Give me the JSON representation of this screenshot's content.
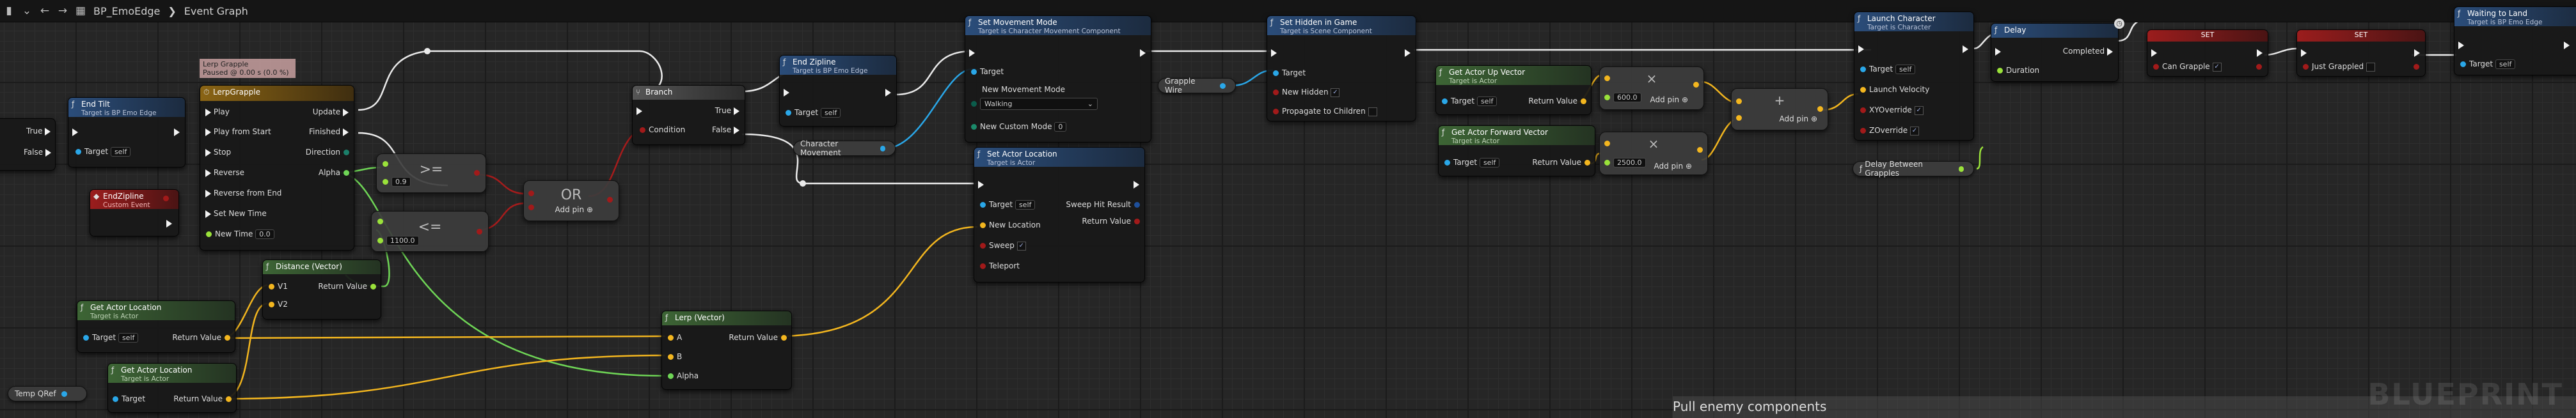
{
  "toolbar": {
    "breadcrumb_root": "BP_EmoEdge",
    "breadcrumb_sep": "❯",
    "breadcrumb_graph": "Event Graph"
  },
  "branch_left": {
    "true_label": "True",
    "false_label": "False"
  },
  "end_tilt": {
    "title": "End Tilt",
    "subtitle": "Target is BP Emo Edge",
    "target_label": "Target",
    "target_value": "self"
  },
  "end_zipline_event": {
    "title": "EndZipline",
    "subtitle": "Custom Event"
  },
  "comment_lerp": {
    "line1": "Lerp Grapple",
    "line2": "Paused @ 0.00 s (0.0 %)"
  },
  "timeline": {
    "title": "LerpGrapple",
    "inputs": [
      "Play",
      "Play from Start",
      "Stop",
      "Reverse",
      "Reverse from End",
      "Set New Time",
      "New Time"
    ],
    "new_time_value": "0.0",
    "outputs": [
      "Update",
      "Finished",
      "Direction",
      "Alpha"
    ]
  },
  "cmp_ge": {
    "symbol": ">=",
    "value": "0.9"
  },
  "cmp_le": {
    "symbol": "<=",
    "value": "1100.0"
  },
  "or_node": {
    "title": "OR",
    "add_pin": "Add pin"
  },
  "branch": {
    "title": "Branch",
    "condition": "Condition",
    "true_label": "True",
    "false_label": "False"
  },
  "end_zipline_fn": {
    "title": "End Zipline",
    "subtitle": "Target is BP Emo Edge",
    "target": "Target",
    "target_value": "self"
  },
  "char_movement_var": "Character Movement",
  "set_movement_mode": {
    "title": "Set Movement Mode",
    "subtitle": "Target is Character Movement Component",
    "target": "Target",
    "new_mode": "New Movement Mode",
    "mode_value": "Walking",
    "custom_mode": "New Custom Mode",
    "custom_value": "0"
  },
  "grapple_wire_var": "Grapple Wire",
  "set_hidden": {
    "title": "Set Hidden in Game",
    "subtitle": "Target is Scene Component",
    "target": "Target",
    "new_hidden": "New Hidden",
    "propagate": "Propagate to Children"
  },
  "set_actor_location": {
    "title": "Set Actor Location",
    "subtitle": "Target is Actor",
    "target": "Target",
    "target_value": "self",
    "new_location": "New Location",
    "sweep": "Sweep",
    "teleport": "Teleport",
    "sweep_hit": "Sweep Hit Result",
    "return_value": "Return Value"
  },
  "distance": {
    "title": "Distance (Vector)",
    "v1": "V1",
    "v2": "V2",
    "ret": "Return Value"
  },
  "get_loc_1": {
    "title": "Get Actor Location",
    "subtitle": "Target is Actor",
    "target": "Target",
    "target_value": "self",
    "ret": "Return Value"
  },
  "get_loc_2": {
    "title": "Get Actor Location",
    "subtitle": "Target is Actor",
    "target": "Target",
    "ret": "Return Value"
  },
  "temp_qref": "Temp QRef",
  "lerp": {
    "title": "Lerp (Vector)",
    "a": "A",
    "b": "B",
    "alpha": "Alpha",
    "ret": "Return Value"
  },
  "get_up": {
    "title": "Get Actor Up Vector",
    "subtitle": "Target is Actor",
    "target": "Target",
    "target_value": "self",
    "ret": "Return Value"
  },
  "get_fwd": {
    "title": "Get Actor Forward Vector",
    "subtitle": "Target is Actor",
    "target": "Target",
    "target_value": "self",
    "ret": "Return Value"
  },
  "mul_1": {
    "symbol": "×",
    "value": "600.0",
    "add_pin": "Add pin"
  },
  "mul_2": {
    "symbol": "×",
    "value": "2500.0",
    "add_pin": "Add pin"
  },
  "add_node": {
    "symbol": "+",
    "add_pin": "Add pin"
  },
  "launch": {
    "title": "Launch Character",
    "subtitle": "Target is Character",
    "target": "Target",
    "target_value": "self",
    "velocity": "Launch Velocity",
    "xy": "XYOverride",
    "z": "ZOverride"
  },
  "delay_var": "Delay Between Grapples",
  "delay": {
    "title": "Delay",
    "completed": "Completed",
    "duration": "Duration"
  },
  "set_can_grapple": {
    "title": "SET",
    "label": "Can Grapple"
  },
  "set_just_grappled": {
    "title": "SET",
    "label": "Just Grappled"
  },
  "waiting": {
    "title": "Waiting to Land",
    "subtitle": "Target is BP Emo Edge",
    "target": "Target",
    "target_value": "self"
  },
  "bottom_comment": "Pull enemy components",
  "watermark": "BLUEPRINT"
}
